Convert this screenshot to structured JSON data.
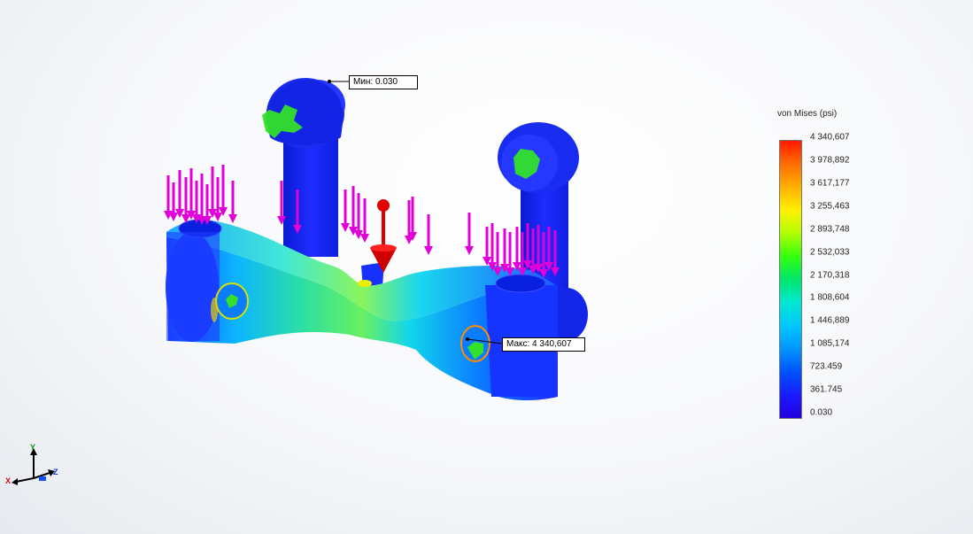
{
  "result_plot": {
    "quantity_label": "von Mises (psi)",
    "colors": {
      "max": "#ff1a00",
      "mid": "#30ff10",
      "min": "#2200e0",
      "load_arrows": "#e000d8",
      "gravity": "#e00000"
    }
  },
  "legend": {
    "ticks": [
      {
        "label": "4 340,607",
        "value": 4340607
      },
      {
        "label": "3 978,892",
        "value": 3978892
      },
      {
        "label": "3 617,177",
        "value": 3617177
      },
      {
        "label": "3 255,463",
        "value": 3255463
      },
      {
        "label": "2 893,748",
        "value": 2893748
      },
      {
        "label": "2 532,033",
        "value": 2532033
      },
      {
        "label": "2 170,318",
        "value": 2170318
      },
      {
        "label": "1 808,604",
        "value": 1808604
      },
      {
        "label": "1 446,889",
        "value": 1446889
      },
      {
        "label": "1 085,174",
        "value": 1085174
      },
      {
        "label": "723.459",
        "value": 723459
      },
      {
        "label": "361.745",
        "value": 361745
      },
      {
        "label": "0.030",
        "value": 0.03
      }
    ]
  },
  "callouts": {
    "min_label": "Мин: 0.030",
    "max_label": "Макс: 4 340,607"
  },
  "triad": {
    "x_label": "X",
    "y_label": "Y",
    "z_label": "Z"
  }
}
